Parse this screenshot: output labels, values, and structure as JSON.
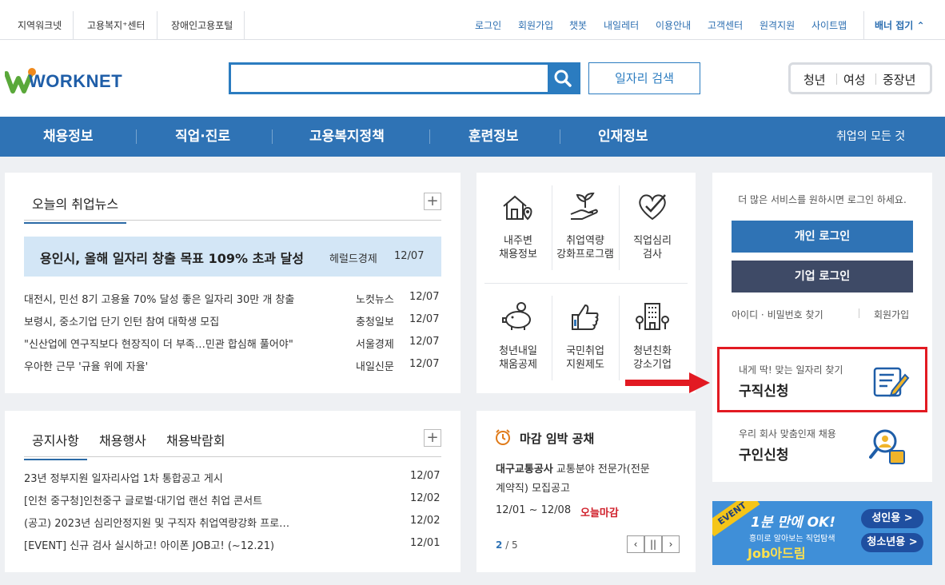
{
  "top_links_left": [
    "지역워크넷",
    "고용복지⁺센터",
    "장애인고용포털"
  ],
  "top_links_right": [
    "로그인",
    "회원가입",
    "챗봇",
    "내일레터",
    "이용안내",
    "고객센터",
    "원격지원",
    "사이트맵"
  ],
  "banner_toggle": "배너 접기",
  "logo": "WORKNET",
  "search": {
    "placeholder": "",
    "job_search_button": "일자리 검색"
  },
  "audience": [
    "청년",
    "여성",
    "중장년"
  ],
  "nav": {
    "items": [
      "채용정보",
      "직업·진로",
      "고용복지정책",
      "훈련정보",
      "인재정보"
    ],
    "right": "취업의 모든 것"
  },
  "news": {
    "tab": "오늘의 취업뉴스",
    "headline": {
      "title": "용인시, 올해 일자리 창출 목표 109% 초과 달성",
      "source": "헤럴드경제",
      "date": "12/07"
    },
    "items": [
      {
        "title": "대전시, 민선 8기 고용율 70% 달성 좋은 일자리 30만 개 창출",
        "source": "노컷뉴스",
        "date": "12/07"
      },
      {
        "title": "보령시, 중소기업 단기 인턴 참여 대학생 모집",
        "source": "충청일보",
        "date": "12/07"
      },
      {
        "title": "\"신산업에 연구직보다 현장직이 더 부족…민관 합심해 풀어야\"",
        "source": "서울경제",
        "date": "12/07"
      },
      {
        "title": "우아한 근무 '규율 위에 자율'",
        "source": "내일신문",
        "date": "12/07"
      }
    ]
  },
  "services": [
    {
      "icon": "house-location-icon",
      "lines": [
        "내주변",
        "채용정보"
      ]
    },
    {
      "icon": "sprout-hand-icon",
      "lines": [
        "취업역량",
        "강화프로그램"
      ]
    },
    {
      "icon": "heart-check-icon",
      "lines": [
        "직업심리",
        "검사"
      ]
    },
    {
      "icon": "piggy-bank-icon",
      "lines": [
        "청년내일",
        "채움공제"
      ]
    },
    {
      "icon": "thumbs-up-icon",
      "lines": [
        "국민취업",
        "지원제도"
      ]
    },
    {
      "icon": "building-icon",
      "lines": [
        "청년친화",
        "강소기업"
      ]
    }
  ],
  "notice": {
    "tabs": [
      "공지사항",
      "채용행사",
      "채용박람회"
    ],
    "items": [
      {
        "title": "23년 정부지원 일자리사업 1차 통합공고 게시",
        "date": "12/07"
      },
      {
        "title": "[인천 중구청]인천중구 글로벌·대기업 랜선 취업 콘서트",
        "date": "12/02"
      },
      {
        "title": "(공고) 2023년 심리안정지원 및 구직자 취업역량강화 프로…",
        "date": "12/02"
      },
      {
        "title": "[EVENT] 신규 검사 실시하고! 아이폰 JOB고! (~12.21)",
        "date": "12/01"
      }
    ]
  },
  "deadline": {
    "title": "마감 임박 공채",
    "company": "대구교통공사",
    "desc1": "교통분야 전문가(전문",
    "desc2": "계약직) 모집공고",
    "period": "12/01 ~ 12/08",
    "status": "오늘마감",
    "page_current": "2",
    "page_total": "/ 5"
  },
  "login": {
    "notice": "더 많은 서비스를 원하시면 로그인 하세요.",
    "personal": "개인 로그인",
    "company": "기업 로그인",
    "find": "아이디 · 비밀번호 찾기",
    "join": "회원가입"
  },
  "job_apply": {
    "sub": "내게 딱! 맞는 일자리 찾기",
    "title": "구직신청"
  },
  "recruit_apply": {
    "sub": "우리 회사 맞춤인재 채용",
    "title": "구인신청"
  },
  "event_banner": {
    "tag": "EVENT",
    "headline": "1분 만에 OK!",
    "sub": "흥미로 알아보는 직업탐색",
    "brand": "Job아드림",
    "adult": "성인용 >",
    "youth": "청소년용 >"
  },
  "colors": {
    "nav": "#2f73b5",
    "personal_login": "#2f73b5",
    "company_login": "#3e4a66",
    "highlight": "#e21a22",
    "headline_bg": "#d3e6f6",
    "deadline": "#e07b1a"
  }
}
